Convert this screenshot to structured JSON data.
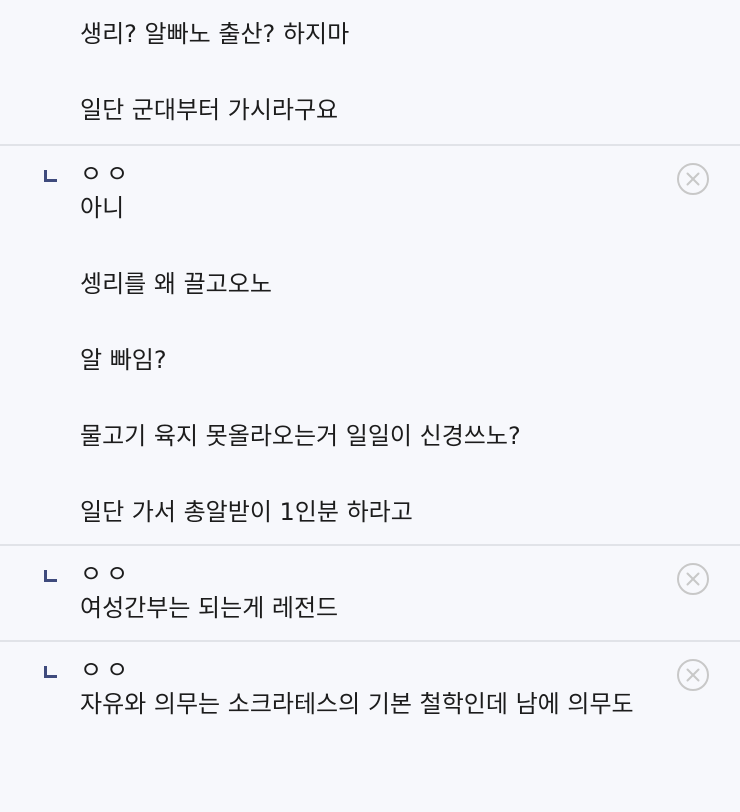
{
  "comments": [
    {
      "lines": [
        "생리? 알빠노 출산? 하지마",
        "일단 군대부터 가시라구요"
      ]
    },
    {
      "author": "ㅇㅇ",
      "close_icon": "circle-x-icon",
      "lines": [
        "아니",
        "셍리를 왜 끌고오노",
        "알 빠임?",
        "물고기 육지 못올라오는거 일일이 신경쓰노?",
        "일단 가서 총알받이 1인분 하라고"
      ]
    },
    {
      "author": "ㅇㅇ",
      "close_icon": "circle-x-icon",
      "lines": [
        "여성간부는 되는게 레전드"
      ]
    },
    {
      "author": "ㅇㅇ",
      "close_icon": "circle-x-icon",
      "lines": [
        "자유와 의무는 소크라테스의 기본 철학인데 남에 의무도"
      ]
    }
  ],
  "colors": {
    "background": "#f7f8fc",
    "divider": "#e1e3e8",
    "reply_marker": "#3f4b7d",
    "close_icon": "#c8c8c8"
  }
}
